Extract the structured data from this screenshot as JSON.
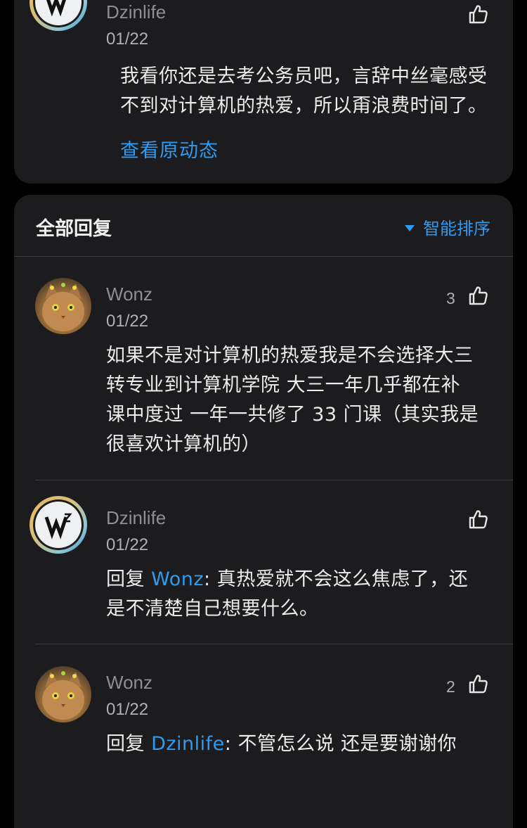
{
  "top_comment": {
    "user": "Dzinlife",
    "date": "01/22",
    "text_line1": "我看你还是去考公务员吧，言辞中丝毫感受",
    "text_line2": "不到对计算机的热爱，所以甭浪费时间了。",
    "view_original": "查看原动态"
  },
  "replies_section": {
    "title": "全部回复",
    "sort_label": "智能排序"
  },
  "replies": [
    {
      "user": "Wonz",
      "date": "01/22",
      "likes": "3",
      "lines": [
        "如果不是对计算机的热爱我是不会选择大三",
        "转专业到计算机学院 大三一年几乎都在补",
        "课中度过 一年一共修了 33 门课（其实我是",
        "很喜欢计算机的）"
      ]
    },
    {
      "user": "Dzinlife",
      "date": "01/22",
      "reply_prefix": "回复 ",
      "reply_to": "Wonz",
      "line1_rest": ": 真热爱就不会这么焦虑了，还",
      "line2": "是不清楚自己想要什么。"
    },
    {
      "user": "Wonz",
      "date": "01/22",
      "likes": "2",
      "reply_prefix": "回复 ",
      "reply_to": "Dzinlife",
      "line1_rest": ": 不管怎么说 还是要谢谢你"
    }
  ],
  "colors": {
    "link": "#2e9bf0",
    "card": "#1c1c1e",
    "background": "#000000"
  },
  "icons": [
    "thumbs-up-icon",
    "sort-caret-icon"
  ]
}
